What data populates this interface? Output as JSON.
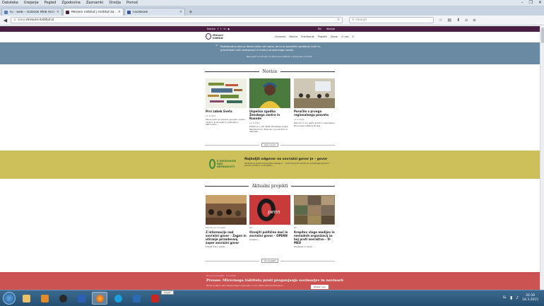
{
  "menubar": [
    "Datoteka",
    "Urejanje",
    "Pogled",
    "Zgodovina",
    "Zaznamki",
    "Orodja",
    "Pomoč"
  ],
  "tabs": [
    {
      "title": "IG - web – Outlook Web Access …",
      "active": false
    },
    {
      "title": "Mirovni inštitut | Inštitut za …",
      "active": true
    },
    {
      "title": "Facebook",
      "active": false
    }
  ],
  "newtab": "+",
  "window_controls": [
    "–",
    "❐",
    "✕"
  ],
  "url": {
    "prefix": "www.",
    "domain": "mirovni-institut.si"
  },
  "search_placeholder": "Iskanje",
  "site": {
    "topstrip_left": [
      "Novice",
      "f",
      "t",
      "in",
      "▶"
    ],
    "topstrip_right": [
      "EN",
      "Iskanje"
    ],
    "logo_text": "Mirovni inštitut",
    "nav": [
      "Osnovno",
      "Novice",
      "Publikacije",
      "Projekti",
      "Zapisi",
      "O nas"
    ],
    "banner_text": "Raziskovalno delo je danes težko več samo, da bi se posvetilo vprašanju moči in, pravičnosti moči nestrpnosti in funkcij strukturnega nasilja.",
    "banner_sub": "Nana Jokić za Vrhnjim pri Mirovnem inštitutu o aktivnosti in družbi"
  },
  "news": {
    "heading": "Novice",
    "more": "Vse novice",
    "cards": [
      {
        "title": "Prvi zabek Sveta",
        "date": "12.3.2015",
        "excerpt": "Kot se rada ne moremo govoriti o pravu, vseeno, ki se sveta in postopke o aktivnostni ..."
      },
      {
        "title": "Uspešna zgodba Ženskega centra in Ruande",
        "date": "12.3.2015",
        "excerpt": "Kolikor je v celi deželi Ženskega centra Mednarodni in Ruande, ki je zanimiv in aktualen ..."
      },
      {
        "title": "Poročilo s prvega regionalnega posveta",
        "date": "12.3.2015",
        "excerpt": "Med 10. in 11. aprila je bilo v organizaciji Mirovnega inštituta skupaj ..."
      }
    ]
  },
  "featured": {
    "logo": "Z ENODOKORI NAD NEENAKOSTI",
    "title": "Najboljši odgovor na sovražni govor je – govor",
    "text": "Konferenca je bila organizirana skupaj z ... a kot ena prvih obravnav sovražnega govora v javnem prostoru in na spletu ..."
  },
  "projects": {
    "heading": "Aktualni projekti",
    "more": "Vsi projekti",
    "cards": [
      {
        "category": "Mednarodni projekti",
        "title": "Z informacijo nad sovražni govor – Zagon in utiranje prizadevanj zoper sovražni govor",
        "excerpt": "Projekt želi v ozadju ..."
      },
      {
        "category": "Mir",
        "title": "Ozvejiti politično moč in sovražni govor – OPENN",
        "excerpt": "Krepitev ..."
      },
      {
        "category": "Mir",
        "title": "Krepitev vloge medijev in nevladnih organizacij za boj proti sovraštvu – D-MED",
        "excerpt": "Povezava in razvoj ..."
      }
    ]
  },
  "bottom": {
    "meta": "Novice iz projekta · 12.3.2015",
    "title": "Prenos: Mirovnega inštituta proti preganjanju novinarjev in novinark",
    "text": "Mirovni inštitut ostro obsoja pregon novinarjev, ki so o aktivnostih poročali javno ...",
    "button": "Preberi več"
  },
  "chat_tab": "Klepet",
  "taskbar": {
    "lang": "SL",
    "time": "20:39",
    "date": "18.3.2015"
  },
  "colors": {
    "topstrip": "#4b1e43",
    "banner_blue": "#6a8aa3",
    "banner_yellow": "#cdc05a",
    "banner_red": "#cb5352"
  }
}
